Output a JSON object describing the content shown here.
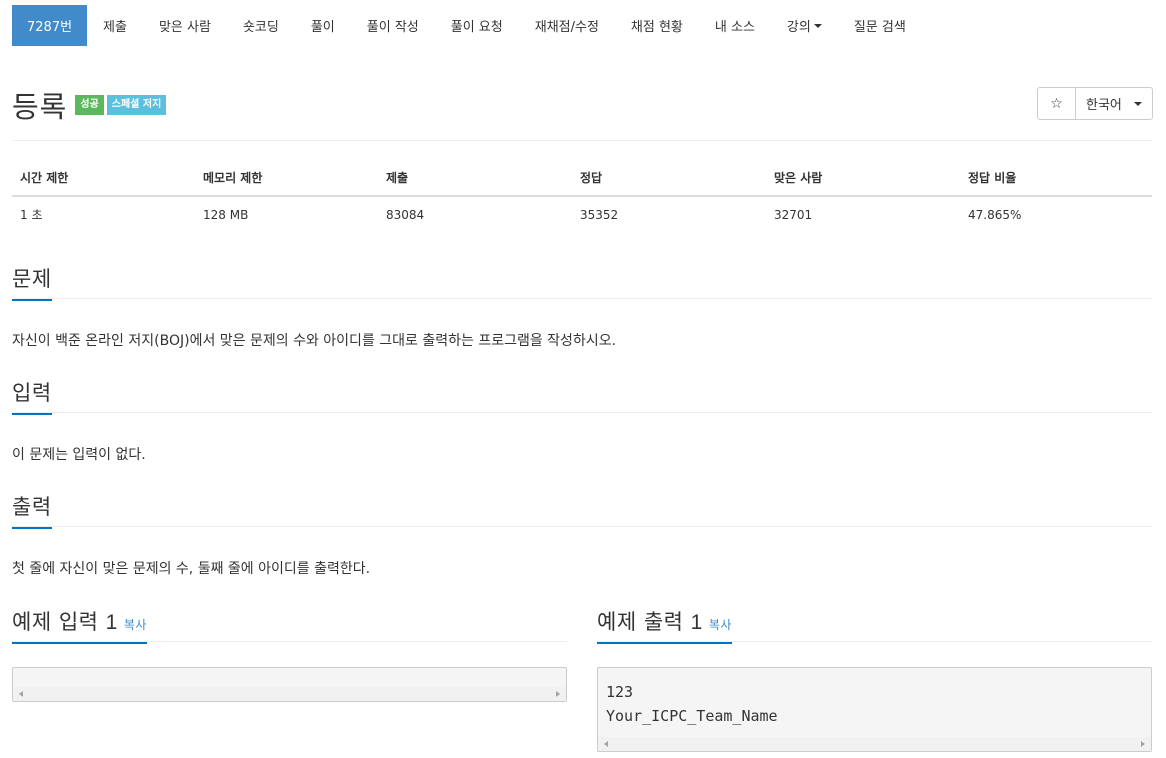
{
  "nav": {
    "items": [
      {
        "label": "7287번",
        "active": true
      },
      {
        "label": "제출"
      },
      {
        "label": "맞은 사람"
      },
      {
        "label": "숏코딩"
      },
      {
        "label": "풀이"
      },
      {
        "label": "풀이 작성"
      },
      {
        "label": "풀이 요청"
      },
      {
        "label": "재채점/수정"
      },
      {
        "label": "채점 현황"
      },
      {
        "label": "내 소스"
      },
      {
        "label": "강의",
        "dropdown": true
      },
      {
        "label": "질문 검색"
      }
    ]
  },
  "problem": {
    "title": "등록",
    "badges": {
      "success": "성공",
      "special_judge": "스페셜 저지"
    }
  },
  "toolbar": {
    "star_icon": "☆",
    "language": "한국어"
  },
  "info": {
    "headers": [
      "시간 제한",
      "메모리 제한",
      "제출",
      "정답",
      "맞은 사람",
      "정답 비율"
    ],
    "values": [
      "1 초",
      "128 MB",
      "83084",
      "35352",
      "32701",
      "47.865%"
    ]
  },
  "sections": {
    "description": {
      "title": "문제",
      "text": "자신이 백준 온라인 저지(BOJ)에서 맞은 문제의 수와 아이디를 그대로 출력하는 프로그램을 작성하시오."
    },
    "input": {
      "title": "입력",
      "text": "이 문제는 입력이 없다."
    },
    "output": {
      "title": "출력",
      "text": "첫 줄에 자신이 맞은 문제의 수, 둘째 줄에 아이디를 출력한다."
    }
  },
  "samples": {
    "input": {
      "title": "예제 입력",
      "num": "1",
      "copy": "복사",
      "lines": []
    },
    "output": {
      "title": "예제 출력",
      "num": "1",
      "copy": "복사",
      "lines": [
        "123",
        "Your_ICPC_Team_Name"
      ]
    }
  },
  "colors": {
    "primary": "#428bca",
    "success": "#5cb85c",
    "info": "#5bc0de",
    "headline_underline": "#0076c0"
  }
}
